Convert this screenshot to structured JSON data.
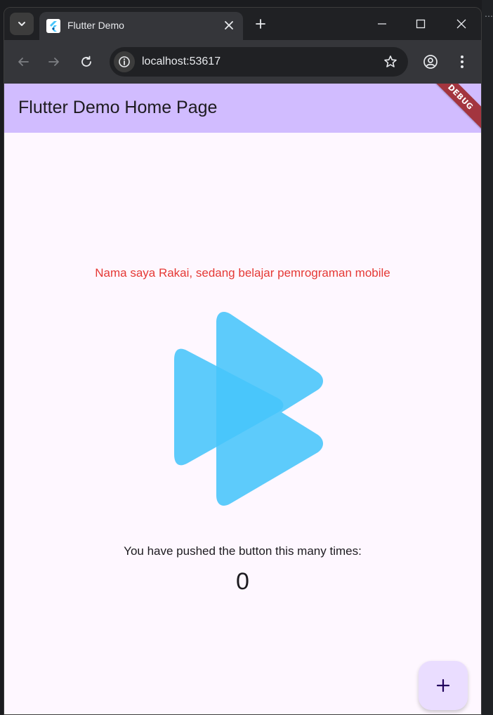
{
  "browser": {
    "tab_title": "Flutter Demo",
    "url": "localhost:53617"
  },
  "app": {
    "appbar_title": "Flutter Demo Home Page",
    "debug_banner": "DEBUG",
    "intro_text": "Nama saya Rakai, sedang belajar pemrograman mobile",
    "counter_label": "You have pushed the button this many times:",
    "counter_value": "0",
    "fab_icon": "+"
  },
  "colors": {
    "appbar": "#d1bcff",
    "background": "#fef7ff",
    "intro_text": "#e53935",
    "logo": "#47c5fb",
    "fab": "#eaddff",
    "debug_banner": "#a3353f"
  },
  "icons": [
    "tab-search-chevron-icon",
    "flutter-favicon-icon",
    "close-icon",
    "plus-icon",
    "minimize-icon",
    "maximize-icon",
    "back-arrow-icon",
    "forward-arrow-icon",
    "reload-icon",
    "info-icon",
    "star-icon",
    "profile-icon",
    "more-vert-icon",
    "flutter-logo-icon",
    "add-icon"
  ]
}
